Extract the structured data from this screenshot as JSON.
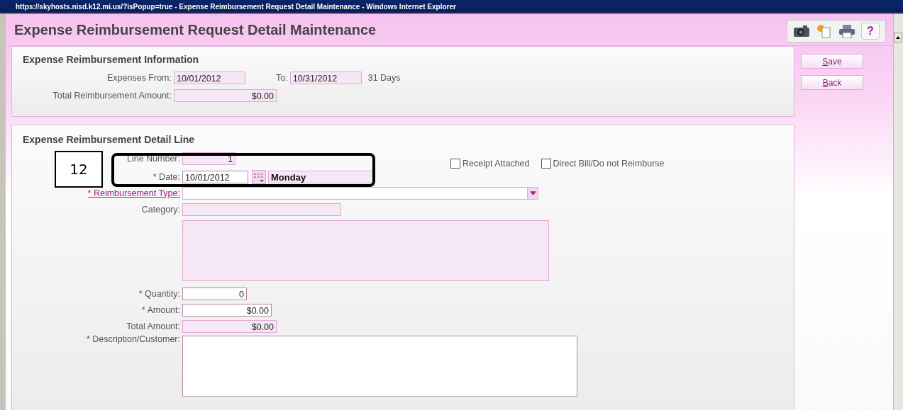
{
  "browser_title": "https://skyhosts.nisd.k12.mi.us/?isPopup=true - Expense Reimbursement Request Detail Maintenance - Windows Internet Explorer",
  "page_title": "Expense Reimbursement Request Detail Maintenance",
  "toolbar": [
    {
      "kind": "camera"
    },
    {
      "kind": "copy"
    },
    {
      "kind": "print"
    },
    {
      "kind": "help",
      "label": "?"
    }
  ],
  "info": {
    "heading": "Expense Reimbursement Information",
    "expenses_from": {
      "label": "Expenses From:",
      "value": "10/01/2012"
    },
    "to": {
      "label": "To:",
      "value": "10/31/2012"
    },
    "days": "31 Days",
    "total": {
      "label": "Total Reimbursement Amount:",
      "value": "$0.00"
    }
  },
  "detail": {
    "heading": "Expense Reimbursement Detail Line",
    "line_number": {
      "label": "Line Number:",
      "value": "1"
    },
    "checkboxes": [
      {
        "label": "Receipt Attached",
        "checked": false
      },
      {
        "label": "Direct Bill/Do not Reimburse",
        "checked": false
      }
    ],
    "date": {
      "label": "* Date:",
      "value": "10/01/2012",
      "day": "Monday"
    },
    "reimbursement_type": {
      "label": "* Reimbursement Type:"
    },
    "category": {
      "label": "Category:"
    },
    "quantity": {
      "label": "* Quantity:",
      "value": "0"
    },
    "amount": {
      "label": "* Amount:",
      "value": "$0.00"
    },
    "total_amount": {
      "label": "Total Amount:",
      "value": "$0.00"
    },
    "description": {
      "label": "* Description/Customer:"
    }
  },
  "buttons": [
    {
      "label": "Save"
    },
    {
      "label": "Back"
    }
  ],
  "callout": {
    "number": "12"
  }
}
